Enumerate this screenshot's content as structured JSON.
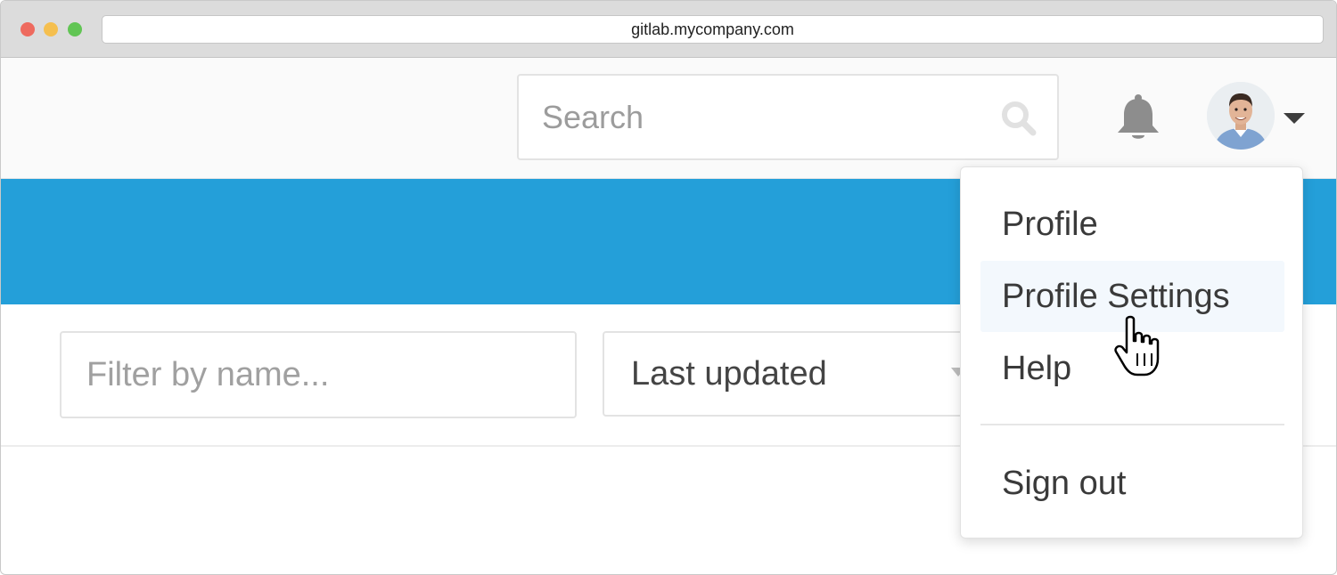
{
  "browser": {
    "url": "gitlab.mycompany.com",
    "traffic_lights": {
      "close_color": "#ee6a5e",
      "minimize_color": "#f5bf4f",
      "maximize_color": "#61c554"
    }
  },
  "header": {
    "search": {
      "placeholder": "Search",
      "icon": "search-icon"
    },
    "notifications_icon": "bell-icon",
    "user_menu": {
      "avatar": "avatar",
      "toggle_icon": "caret-down-icon"
    }
  },
  "banner": {
    "color": "#249fd9"
  },
  "filters": {
    "name_filter": {
      "placeholder": "Filter by name..."
    },
    "sort": {
      "selected": "Last updated",
      "icon": "chevron-down-icon"
    }
  },
  "user_dropdown": {
    "items": [
      {
        "label": "Profile"
      },
      {
        "label": "Profile Settings",
        "highlighted": true
      },
      {
        "label": "Help"
      }
    ],
    "sign_out_label": "Sign out",
    "highlight_color": "#f3f8fd"
  },
  "cursor": {
    "type": "hand-pointer-icon",
    "over": "Profile Settings"
  }
}
